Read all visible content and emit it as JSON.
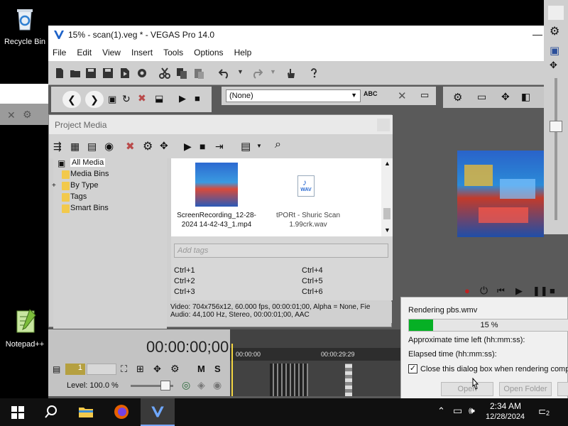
{
  "desktop": {
    "recycle_bin": "Recycle Bin",
    "notepad": "Notepad++"
  },
  "window": {
    "title": "15% - scan(1).veg * - VEGAS Pro 14.0",
    "menus": [
      "File",
      "Edit",
      "View",
      "Insert",
      "Tools",
      "Options",
      "Help"
    ]
  },
  "trimmer": {
    "select_value": "(None)"
  },
  "project_media": {
    "title": "Project Media",
    "tree": [
      "All Media",
      "Media Bins",
      "By Type",
      "Tags",
      "Smart Bins"
    ],
    "tree_expander": "+",
    "files": [
      {
        "name": "ScreenRecording_12-28-2024 14-42-43_1.mp4"
      },
      {
        "name": "tPORt - Shuric Scan 1.99crk.wav",
        "badge": "WAV"
      }
    ],
    "tags_placeholder": "Add tags",
    "shortcuts": [
      "Ctrl+1",
      "Ctrl+2",
      "Ctrl+3",
      "Ctrl+4",
      "Ctrl+5",
      "Ctrl+6"
    ],
    "status_video": "Video: 704x756x12, 60.000 fps, 00:00:01;00, Alpha = None, Fie",
    "status_audio": "Audio: 44,100 Hz, Stereo, 00:00:01;00, AAC"
  },
  "timeline": {
    "timecode": "00:00:00;00",
    "track_number": "1",
    "level": "Level: 100.0 %",
    "m_label": "M",
    "s_label": "S",
    "ruler_start": "00:00:00",
    "ruler_mark": "00:00:29:29"
  },
  "render_dialog": {
    "title": "Rendering pbs.wmv",
    "progress_text": "15 %",
    "progress_value": 0.15,
    "time_left_label": "Approximate time left (hh:mm:ss):",
    "elapsed_label": "Elapsed time (hh:mm:ss):",
    "close_checkbox_label": "Close this dialog box when rendering comple",
    "open_button": "Open",
    "open_folder_button": "Open Folder"
  },
  "taskbar": {
    "time": "2:34 AM",
    "date": "12/28/2024",
    "notification_count": "2"
  },
  "colors": {
    "progress_green": "#06b025",
    "panel_gray": "#cfcfcf",
    "dark_gray": "#5a5a5a"
  }
}
